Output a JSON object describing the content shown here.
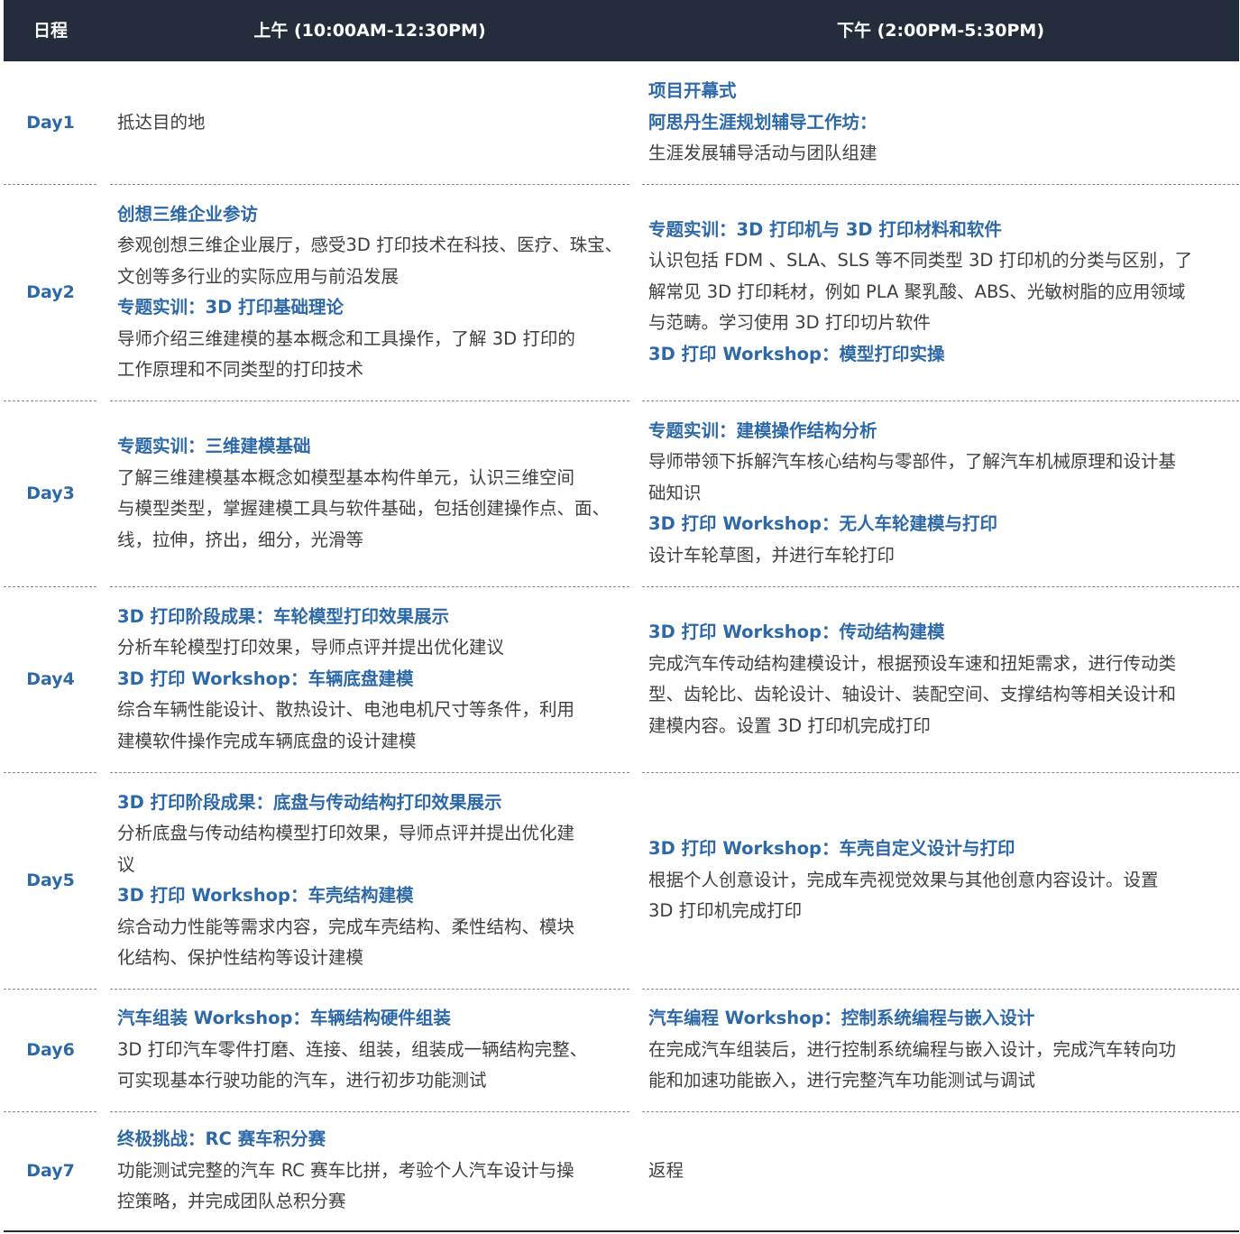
{
  "header": {
    "day": "日程",
    "am": "上午 (10:00AM-12:30PM)",
    "pm": "下午 (2:00PM-5:30PM)"
  },
  "rows": [
    {
      "day": "Day1",
      "am": [
        {
          "text": "抵达目的地",
          "title": false
        }
      ],
      "pm": [
        {
          "text": "项目开幕式",
          "title": true
        },
        {
          "text": "阿思丹生涯规划辅导工作坊：",
          "title": true
        },
        {
          "text": "生涯发展辅导活动与团队组建",
          "title": false
        }
      ]
    },
    {
      "day": "Day2",
      "am": [
        {
          "text": "创想三维企业参访",
          "title": true
        },
        {
          "text": "参观创想三维企业展厅，感受3D 打印技术在科技、医疗、珠宝、",
          "title": false
        },
        {
          "text": "文创等多行业的实际应用与前沿发展",
          "title": false
        },
        {
          "text": "专题实训：3D 打印基础理论",
          "title": true
        },
        {
          "text": "导师介绍三维建模的基本概念和工具操作，了解 3D 打印的",
          "title": false
        },
        {
          "text": "工作原理和不同类型的打印技术",
          "title": false
        }
      ],
      "pm": [
        {
          "text": "专题实训：3D 打印机与 3D 打印材料和软件",
          "title": true
        },
        {
          "text": "认识包括 FDM 、SLA、SLS 等不同类型 3D 打印机的分类与区别，了",
          "title": false
        },
        {
          "text": "解常见 3D 打印耗材，例如 PLA 聚乳酸、ABS、光敏树脂的应用领域",
          "title": false
        },
        {
          "text": "与范畴。学习使用 3D 打印切片软件",
          "title": false
        },
        {
          "text": "3D 打印 Workshop：模型打印实操",
          "title": true
        }
      ]
    },
    {
      "day": "Day3",
      "am": [
        {
          "text": "专题实训：三维建模基础",
          "title": true
        },
        {
          "text": "了解三维建模基本概念如模型基本构件单元，认识三维空间",
          "title": false
        },
        {
          "text": "与模型类型，掌握建模工具与软件基础，包括创建操作点、面、",
          "title": false
        },
        {
          "text": "线，拉伸，挤出，细分，光滑等",
          "title": false
        }
      ],
      "pm": [
        {
          "text": "专题实训：建模操作结构分析",
          "title": true
        },
        {
          "text": "导师带领下拆解汽车核心结构与零部件，了解汽车机械原理和设计基",
          "title": false
        },
        {
          "text": "础知识",
          "title": false
        },
        {
          "text": "3D 打印 Workshop：无人车轮建模与打印",
          "title": true
        },
        {
          "text": "设计车轮草图，并进行车轮打印",
          "title": false
        }
      ]
    },
    {
      "day": "Day4",
      "am": [
        {
          "text": "3D 打印阶段成果：车轮模型打印效果展示",
          "title": true
        },
        {
          "text": "分析车轮模型打印效果，导师点评并提出优化建议",
          "title": false
        },
        {
          "text": "3D 打印 Workshop：车辆底盘建模",
          "title": true
        },
        {
          "text": "综合车辆性能设计、散热设计、电池电机尺寸等条件，利用",
          "title": false
        },
        {
          "text": "建模软件操作完成车辆底盘的设计建模",
          "title": false
        }
      ],
      "pm": [
        {
          "text": "3D 打印 Workshop：传动结构建模",
          "title": true
        },
        {
          "text": "完成汽车传动结构建模设计，根据预设车速和扭矩需求，进行传动类",
          "title": false
        },
        {
          "text": "型、齿轮比、齿轮设计、轴设计、装配空间、支撑结构等相关设计和",
          "title": false
        },
        {
          "text": "建模内容。设置 3D 打印机完成打印",
          "title": false
        }
      ]
    },
    {
      "day": "Day5",
      "am": [
        {
          "text": "3D 打印阶段成果：底盘与传动结构打印效果展示",
          "title": true
        },
        {
          "text": "分析底盘与传动结构模型打印效果，导师点评并提出优化建",
          "title": false
        },
        {
          "text": "议",
          "title": false
        },
        {
          "text": "3D 打印 Workshop：车壳结构建模",
          "title": true
        },
        {
          "text": "综合动力性能等需求内容，完成车壳结构、柔性结构、模块",
          "title": false
        },
        {
          "text": "化结构、保护性结构等设计建模",
          "title": false
        }
      ],
      "pm": [
        {
          "text": "3D 打印 Workshop：车壳自定义设计与打印",
          "title": true
        },
        {
          "text": "根据个人创意设计，完成车壳视觉效果与其他创意内容设计。设置",
          "title": false
        },
        {
          "text": "3D 打印机完成打印",
          "title": false
        }
      ]
    },
    {
      "day": "Day6",
      "am": [
        {
          "text": "汽车组装 Workshop：车辆结构硬件组装",
          "title": true
        },
        {
          "text": "3D 打印汽车零件打磨、连接、组装，组装成一辆结构完整、",
          "title": false
        },
        {
          "text": "可实现基本行驶功能的汽车，进行初步功能测试",
          "title": false
        }
      ],
      "pm": [
        {
          "text": "汽车编程 Workshop：控制系统编程与嵌入设计",
          "title": true
        },
        {
          "text": "在完成汽车组装后，进行控制系统编程与嵌入设计，完成汽车转向功",
          "title": false
        },
        {
          "text": "能和加速功能嵌入，进行完整汽车功能测试与调试",
          "title": false
        }
      ]
    },
    {
      "day": "Day7",
      "am": [
        {
          "text": "终极挑战：RC 赛车积分赛",
          "title": true
        },
        {
          "text": "功能测试完整的汽车 RC 赛车比拼，考验个人汽车设计与操",
          "title": false
        },
        {
          "text": "控策略，并完成团队总积分赛",
          "title": false
        }
      ],
      "pm": [
        {
          "text": "返程",
          "title": false
        }
      ]
    }
  ]
}
